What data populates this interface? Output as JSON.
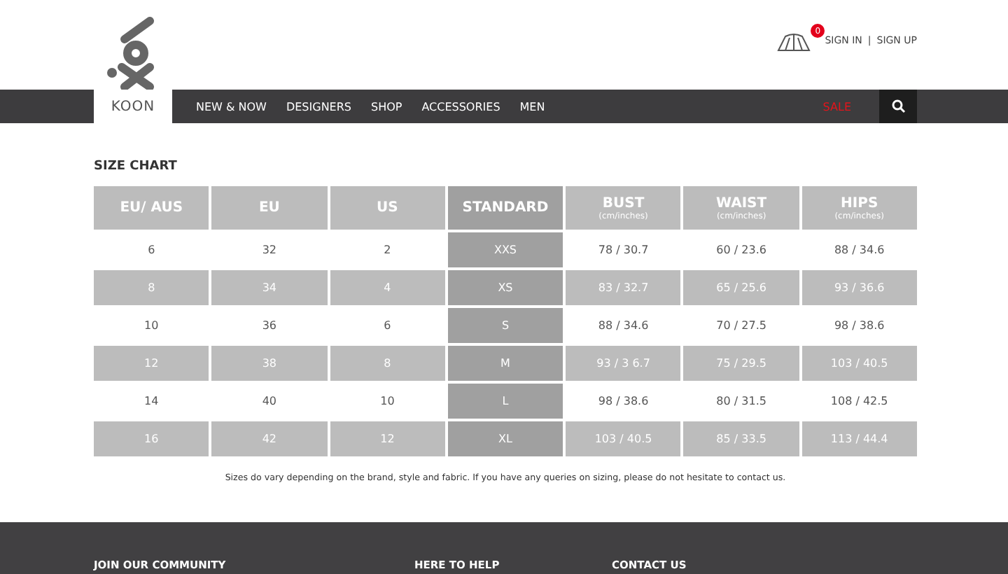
{
  "header": {
    "logo_text": "KOON",
    "cart_count": "0",
    "auth": [
      "SIGN IN",
      "SIGN UP"
    ],
    "auth_separator": "|"
  },
  "nav": {
    "items": [
      "NEW & NOW",
      "DESIGNERS",
      "SHOP",
      "ACCESSORIES",
      "MEN"
    ],
    "sale": "SALE"
  },
  "size_chart": {
    "title": "SIZE CHART",
    "columns": [
      {
        "label": "EU/ AUS",
        "highlighted": false
      },
      {
        "label": "EU",
        "highlighted": false
      },
      {
        "label": "US",
        "highlighted": false
      },
      {
        "label": "STANDARD",
        "highlighted": true
      },
      {
        "label": "BUST",
        "sub": "(cm/inches)",
        "highlighted": false
      },
      {
        "label": "WAIST",
        "sub": "(cm/inches)",
        "highlighted": false
      },
      {
        "label": "HIPS",
        "sub": "(cm/inches)",
        "highlighted": false
      }
    ],
    "rows": [
      [
        "6",
        "32",
        "2",
        "XXS",
        "78 / 30.7",
        "60 / 23.6",
        "88 / 34.6"
      ],
      [
        "8",
        "34",
        "4",
        "XS",
        "83 / 32.7",
        "65 / 25.6",
        "93 / 36.6"
      ],
      [
        "10",
        "36",
        "6",
        "S",
        "88 / 34.6",
        "70 / 27.5",
        "98 / 38.6"
      ],
      [
        "12",
        "38",
        "8",
        "M",
        "93 / 3 6.7",
        "75 / 29.5",
        "103 / 40.5"
      ],
      [
        "14",
        "40",
        "10",
        "L",
        "98 / 38.6",
        "80 / 31.5",
        "108 / 42.5"
      ],
      [
        "16",
        "42",
        "12",
        "XL",
        "103 / 40.5",
        "85 / 33.5",
        "113 / 44.4"
      ]
    ],
    "note": "Sizes do vary depending on the brand, style and fabric. If you have any queries on sizing, please do not hesitate to contact us."
  },
  "footer": {
    "headings": [
      "JOIN OUR COMMUNITY",
      "HERE TO HELP",
      "CONTACT US"
    ]
  }
}
